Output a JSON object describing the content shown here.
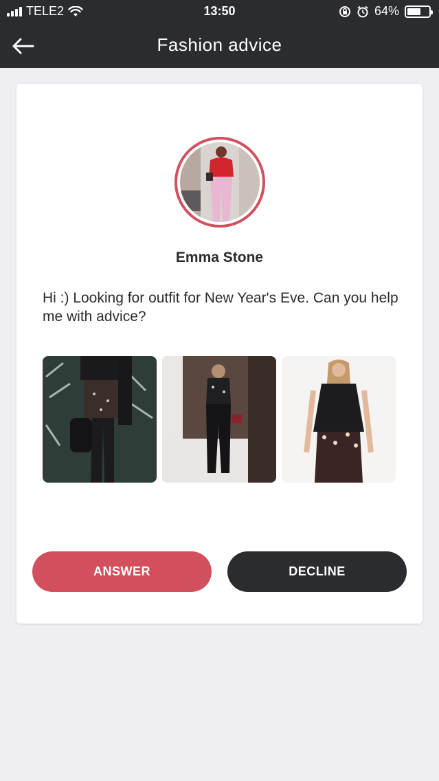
{
  "status_bar": {
    "carrier": "TELE2",
    "time": "13:50",
    "battery": "64%",
    "battery_level": 0.64
  },
  "header": {
    "title": "Fashion advice",
    "back_icon": "arrow-left-icon"
  },
  "request": {
    "user_name": "Emma Stone",
    "message": "Hi :) Looking for outfit for New Year's Eve. Can you help me with advice?"
  },
  "actions": {
    "answer_label": "ANSWER",
    "decline_label": "DECLINE"
  },
  "colors": {
    "header_bg": "#2b2c2f",
    "accent": "#d2505e",
    "dark_button": "#2b2c2f",
    "page_bg": "#efeef2"
  }
}
